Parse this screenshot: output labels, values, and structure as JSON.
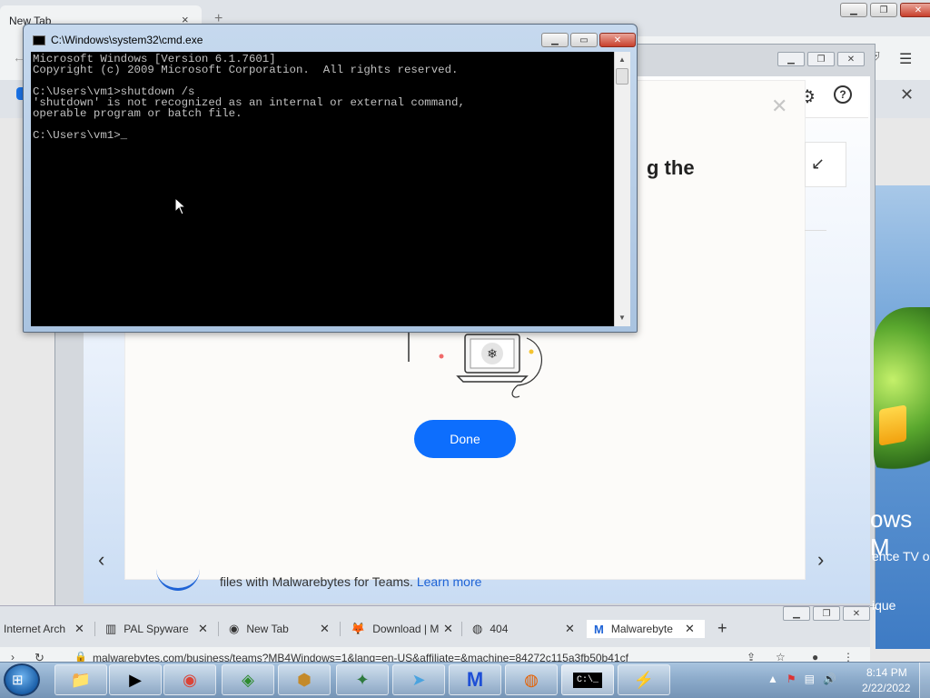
{
  "bg_browser": {
    "tab_title": "New Tab",
    "close_glyph": "×",
    "new_tab_glyph": "+"
  },
  "malwarebytes": {
    "heading_fragment": "g the",
    "done_label": "Done",
    "footer_text": "files with Malwarebytes for Teams.",
    "footer_link": "Learn more",
    "wallpaper_text1": "ows M",
    "wallpaper_text2": "ence TV o",
    "wallpaper_text3": "ique"
  },
  "cmd": {
    "title": "C:\\Windows\\system32\\cmd.exe",
    "output": "Microsoft Windows [Version 6.1.7601]\nCopyright (c) 2009 Microsoft Corporation.  All rights reserved.\n\nC:\\Users\\vm1>shutdown /s\n'shutdown' is not recognized as an internal or external command,\noperable program or batch file.\n\nC:\\Users\\vm1>_"
  },
  "bottom_browser": {
    "tabs": [
      {
        "label": "Internet Arch",
        "icon": "archive-icon"
      },
      {
        "label": "PAL Spyware",
        "icon": "bank-icon"
      },
      {
        "label": "New Tab",
        "icon": "chrome-icon"
      },
      {
        "label": "Download | M",
        "icon": "metamask-icon"
      },
      {
        "label": "404",
        "icon": "globe-icon"
      },
      {
        "label": "Malwarebyte",
        "icon": "malwarebytes-icon"
      }
    ],
    "url": "malwarebytes.com/business/teams?MB4Windows=1&lang=en-US&affiliate=&machine=84272c115a3fb50b41cf"
  },
  "taskbar": {
    "apps": [
      {
        "name": "explorer",
        "glyph": "📁"
      },
      {
        "name": "media-player",
        "glyph": "▶"
      },
      {
        "name": "chrome",
        "glyph": "◉"
      },
      {
        "name": "windows-update",
        "glyph": "◈"
      },
      {
        "name": "shield-app",
        "glyph": "⬢"
      },
      {
        "name": "network-app",
        "glyph": "✦"
      },
      {
        "name": "send-app",
        "glyph": "➤"
      },
      {
        "name": "malwarebytes",
        "glyph": "M"
      },
      {
        "name": "firefox",
        "glyph": "◍"
      },
      {
        "name": "cmd",
        "glyph": "C:\\_"
      },
      {
        "name": "avast",
        "glyph": "⚡"
      }
    ],
    "time": "8:14 PM",
    "date": "2/22/2022"
  },
  "colors": {
    "done_button": "#0d6efd",
    "cmd_text": "#c0c0c0",
    "link": "#1e63d6"
  }
}
